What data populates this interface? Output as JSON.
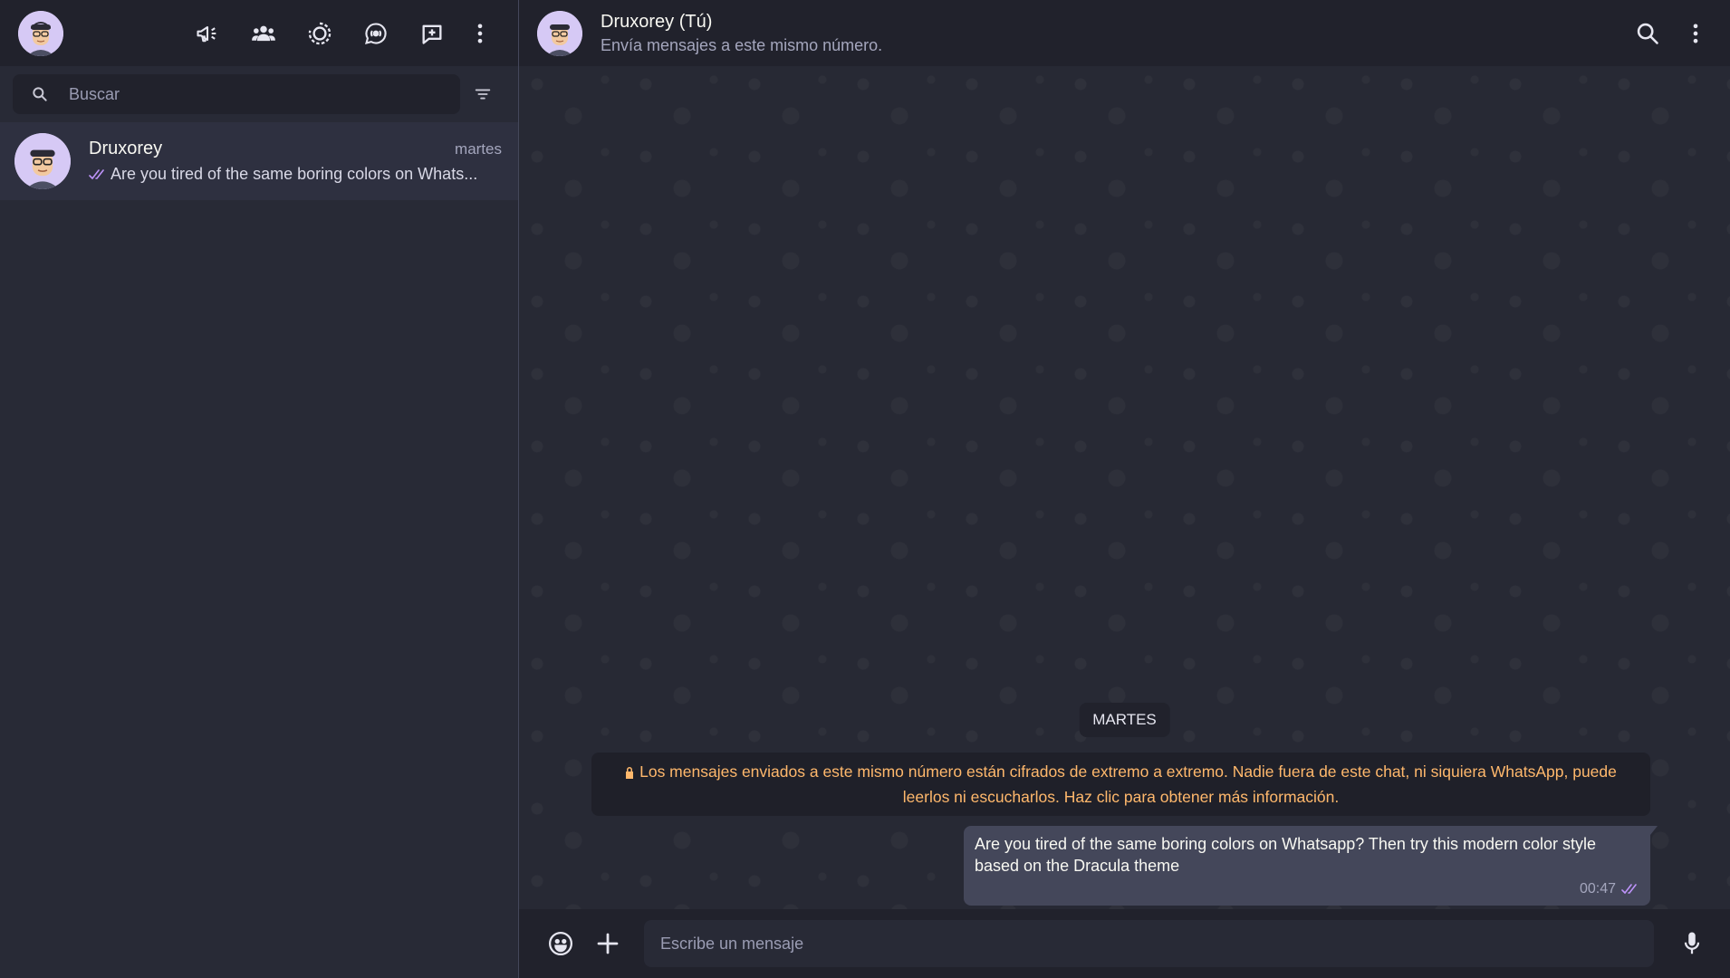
{
  "sidebar": {
    "search": {
      "placeholder": "Buscar"
    },
    "chats": [
      {
        "name": "Druxorey",
        "time": "martes",
        "preview": "Are you tired of the same boring colors on Whats..."
      }
    ]
  },
  "chat": {
    "contact_name": "Druxorey (Tú)",
    "contact_subtitle": "Envía mensajes a este mismo número.",
    "date_chip": "MARTES",
    "encryption_notice": "Los mensajes enviados a este mismo número están cifrados de extremo a extremo. Nadie fuera de este chat, ni siquiera WhatsApp, puede leerlos ni escucharlos. Haz clic para obtener más información.",
    "messages": [
      {
        "text": "Are you tired of the same boring colors on Whatsapp? Then try this modern color style based on the Dracula theme",
        "time": "00:47"
      }
    ]
  },
  "composer": {
    "placeholder": "Escribe un mensaje"
  },
  "colors": {
    "background": "#282a36",
    "header": "#21222c",
    "bubble": "#44475a",
    "accent_purple": "#bd93f9",
    "notice_orange": "#ffb86c"
  }
}
